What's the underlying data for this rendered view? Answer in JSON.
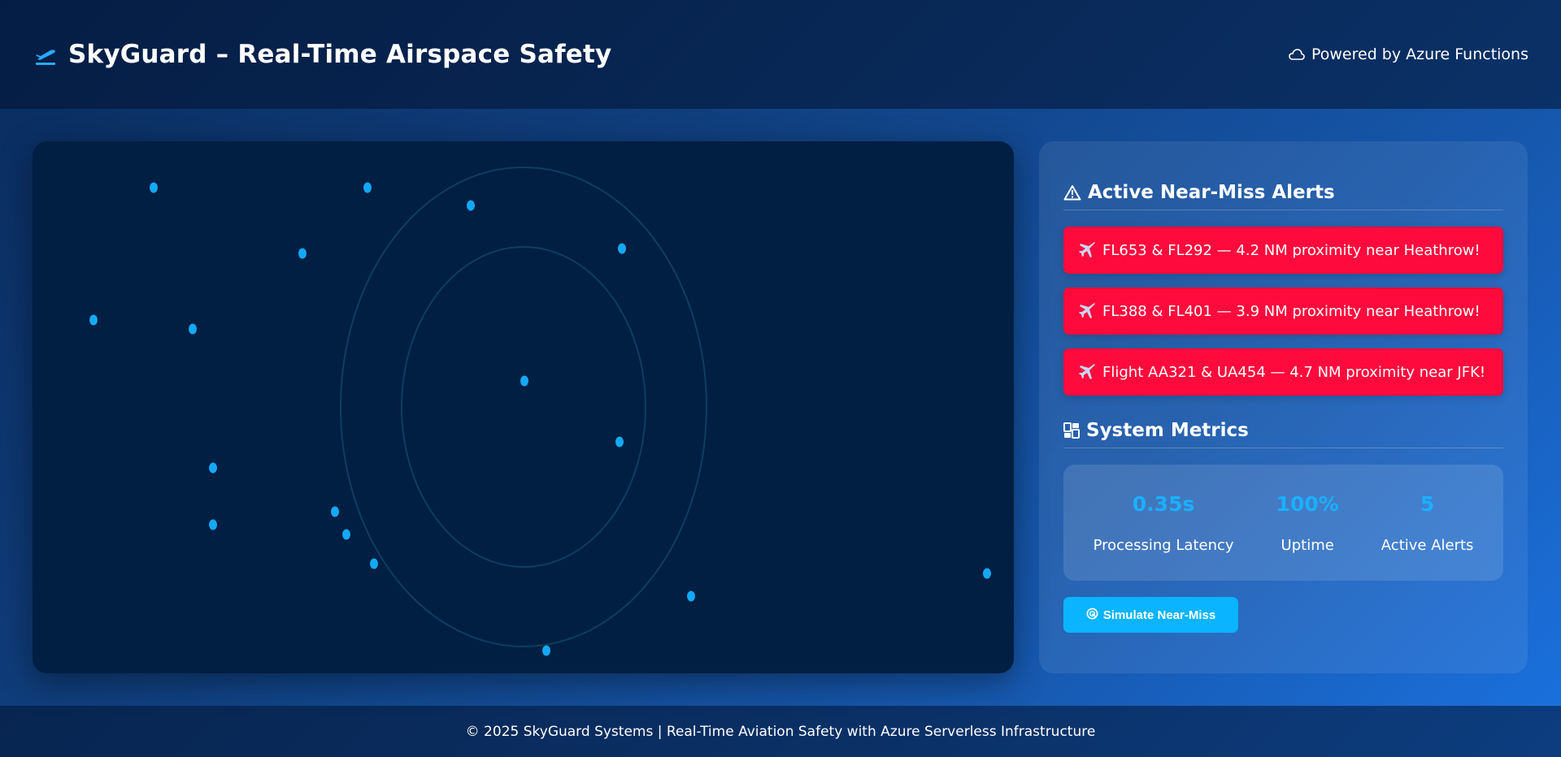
{
  "header": {
    "title": "SkyGuard – Real-Time Airspace Safety",
    "brand_icon": "airplane-departure-icon",
    "powered_by": "Powered by Azure Functions",
    "powered_icon": "cloud-icon"
  },
  "radar": {
    "ring_color": "#0d3f5e",
    "blip_color": "#14a9f5",
    "blip_count": 17
  },
  "alerts": {
    "title": "Active Near-Miss Alerts",
    "title_icon": "warning-icon",
    "item_icon": "airplane-icon",
    "items": [
      {
        "text": "FL653 & FL292 — 4.2 NM proximity near Heathrow!"
      },
      {
        "text": "FL388 & FL401 — 3.9 NM proximity near Heathrow!"
      },
      {
        "text": "Flight AA321 & UA454 — 4.7 NM proximity near JFK!"
      }
    ],
    "color": "#ff0a3c"
  },
  "metrics": {
    "title": "System Metrics",
    "title_icon": "dashboard-icon",
    "items": [
      {
        "value": "0.35s",
        "label": "Processing Latency"
      },
      {
        "value": "100%",
        "label": "Uptime"
      },
      {
        "value": "5",
        "label": "Active Alerts"
      }
    ],
    "value_color": "#1ab0ff"
  },
  "actions": {
    "simulate_label": "Simulate Near-Miss",
    "simulate_icon": "radar-icon"
  },
  "footer": {
    "text": "© 2025 SkyGuard Systems | Real-Time Aviation Safety with Azure Serverless Infrastructure"
  }
}
